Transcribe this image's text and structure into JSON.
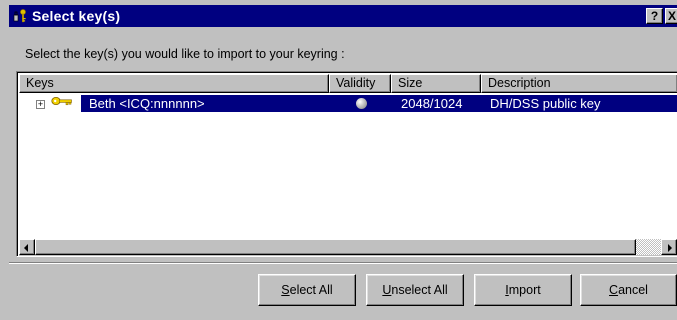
{
  "window": {
    "title": "Select key(s)",
    "help_label": "?",
    "close_label": "X"
  },
  "prompt": "Select the key(s) you would like to import to your keyring :",
  "table": {
    "columns": [
      "Keys",
      "Validity",
      "Size",
      "Description"
    ],
    "rows": [
      {
        "expander": "+",
        "name": "Beth  <ICQ:nnnnnn>",
        "validity": "valid",
        "size": "2048/1024",
        "description": "DH/DSS public key",
        "selected": true
      }
    ]
  },
  "buttons": {
    "select_all": {
      "mnemonic": "S",
      "rest": "elect All"
    },
    "unselect_all": {
      "mnemonic": "U",
      "rest": "nselect All"
    },
    "import": {
      "mnemonic": "I",
      "rest": "mport"
    },
    "cancel": {
      "mnemonic": "C",
      "rest": "ancel"
    }
  },
  "colors": {
    "titlebar": "#000080",
    "selection": "#000080",
    "face": "#c0c0c0"
  },
  "icons": [
    "key-lock-icon",
    "help-icon",
    "close-icon",
    "key-icon",
    "validity-orb-icon",
    "scroll-left-icon",
    "scroll-right-icon"
  ]
}
